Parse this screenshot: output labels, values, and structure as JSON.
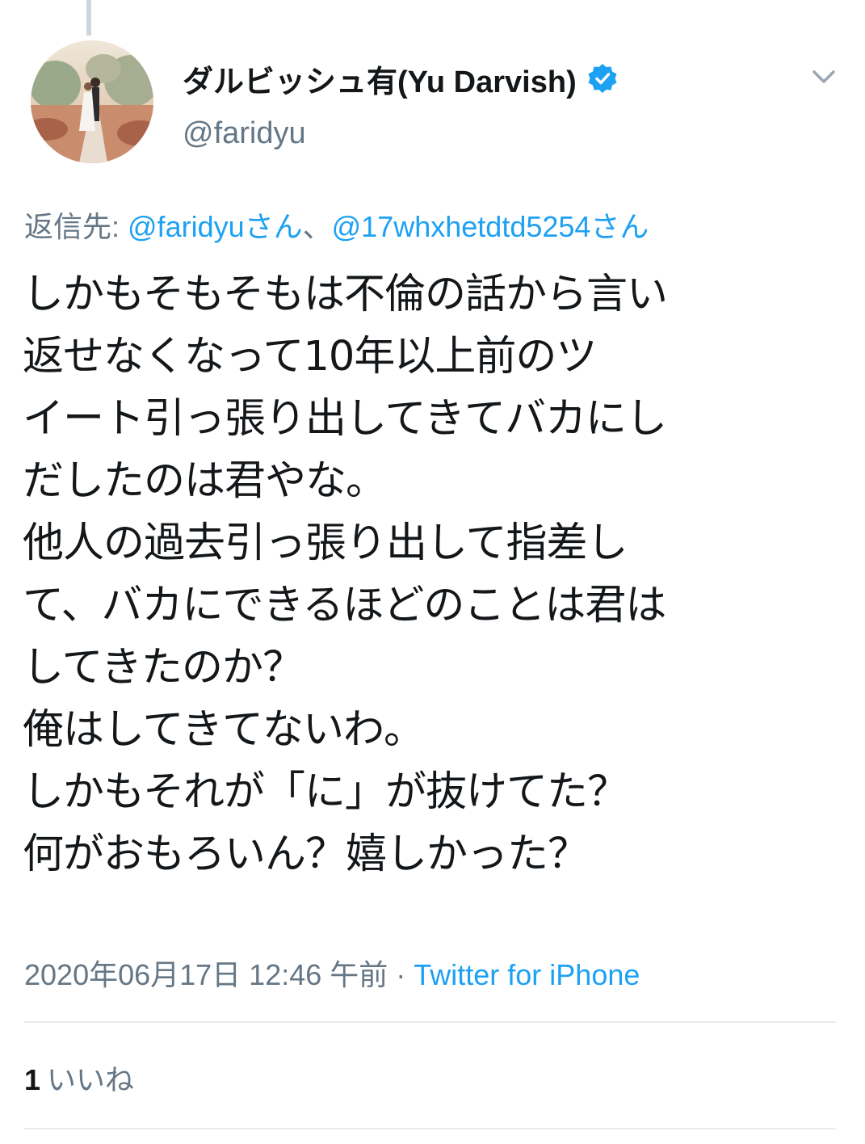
{
  "author": {
    "display_name": "ダルビッシュ有(Yu Darvish)",
    "handle": "@faridyu",
    "verified": true,
    "avatar_icon": "profile-photo"
  },
  "reply": {
    "prefix": "返信先: ",
    "mention_1": "@faridyuさん",
    "separator": "、",
    "mention_2": "@17whxhetdtd5254さん"
  },
  "tweet": {
    "text": "しかもそもそもは不倫の話から言い\n返せなくなって10年以上前のツ\nイート引っ張り出してきてバカにし\nだしたのは君やな。\n他人の過去引っ張り出して指差し\nて、バカにできるほどのことは君は\nしてきたのか？\n俺はしてきてないわ。\nしかもそれが「に」が抜けてた？\n何がおもろいん？嬉しかった？"
  },
  "meta": {
    "timestamp": "2020年06月17日 12:46 午前",
    "separator": " · ",
    "source": "Twitter for iPhone"
  },
  "stats": {
    "like_count": "1",
    "like_label": "いいね"
  },
  "colors": {
    "accent": "#1da1f2",
    "secondary_text": "#657786",
    "primary_text": "#14171a",
    "divider": "#e6ecf0"
  }
}
